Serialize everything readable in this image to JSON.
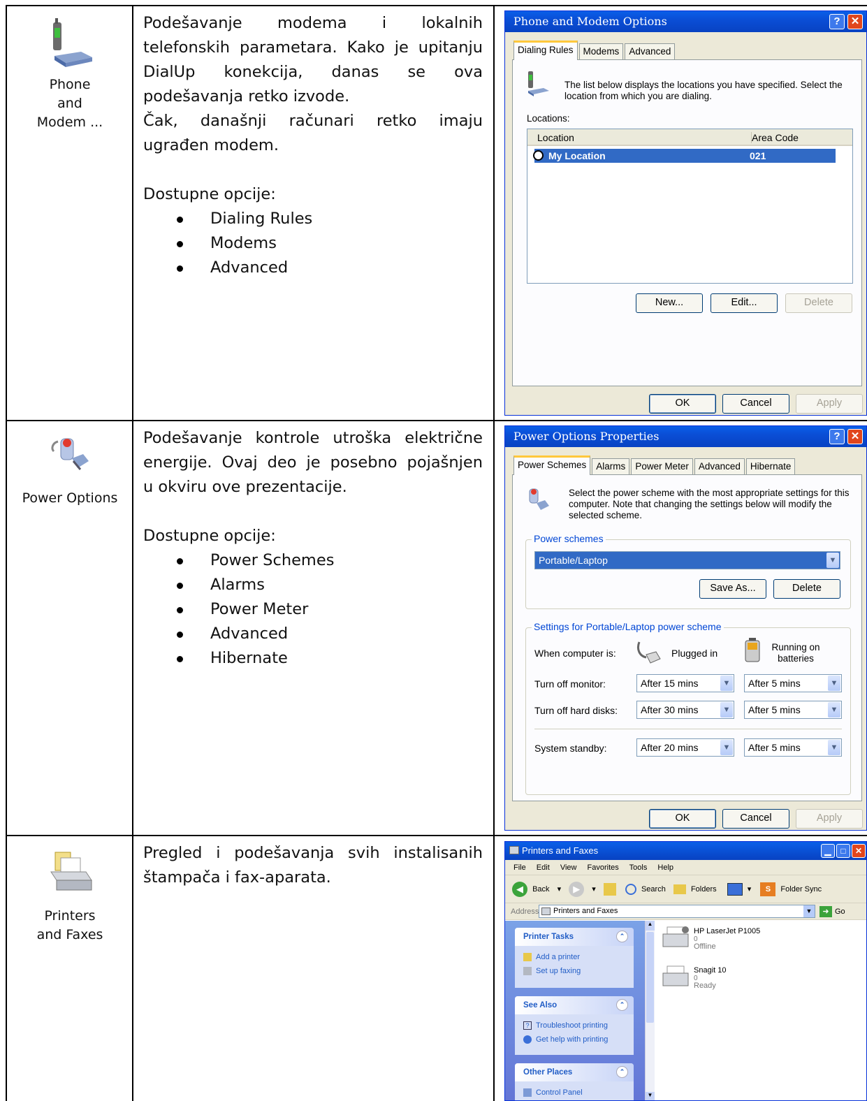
{
  "rows": [
    {
      "icon_label": "Phone and Modem ...",
      "icon": "phone-modem-icon",
      "para1": [
        "Podešavanje modema i lokalnih",
        "telefonskih parametara. Kako je upitanju",
        "DialUp konekcija, danas se ova",
        "podešavanja retko izvode."
      ],
      "para2": [
        "Čak, današnji računari retko imaju",
        "ugrađen modem."
      ],
      "options_title": "Dostupne opcije:",
      "options": [
        "Dialing Rules",
        "Modems",
        "Advanced"
      ]
    },
    {
      "icon_label": "Power Options",
      "icon": "power-options-icon",
      "para1": [
        "Podešavanje kontrole utroška električne",
        "energije. Ovaj deo je posebno pojašnjen",
        "u okviru ove prezentacije."
      ],
      "options_title": "Dostupne opcije:",
      "options": [
        "Power Schemes",
        "Alarms",
        "Power Meter",
        "Advanced",
        "Hibernate"
      ]
    },
    {
      "icon_label": "Printers and Faxes",
      "icon": "printers-faxes-icon",
      "para1": [
        "Pregled i podešavanja svih instalisanih",
        "štampača i fax-aparata."
      ]
    }
  ],
  "phone_dialog": {
    "title": "Phone and Modem Options",
    "tabs": [
      "Dialing Rules",
      "Modems",
      "Advanced"
    ],
    "description": "The list below displays the locations you have specified. Select the location from which you are dialing.",
    "locations_label": "Locations:",
    "columns": [
      "Location",
      "Area Code"
    ],
    "rows": [
      {
        "location": "My Location",
        "area_code": "021"
      }
    ],
    "buttons": [
      "New...",
      "Edit...",
      "Delete"
    ],
    "footer": [
      "OK",
      "Cancel",
      "Apply"
    ]
  },
  "power_dialog": {
    "title": "Power Options Properties",
    "tabs": [
      "Power Schemes",
      "Alarms",
      "Power Meter",
      "Advanced",
      "Hibernate"
    ],
    "description": "Select the power scheme with the most appropriate settings for this computer. Note that changing the settings below will modify the selected scheme.",
    "schemes_group": "Power schemes",
    "scheme_value": "Portable/Laptop",
    "save_as": "Save As...",
    "delete": "Delete",
    "settings_group": "Settings for Portable/Laptop power scheme",
    "when_label": "When computer is:",
    "plugged": "Plugged in",
    "batteries": "Running on batteries",
    "settings": [
      {
        "label": "Turn off monitor:",
        "plugged": "After 15 mins",
        "battery": "After 5 mins"
      },
      {
        "label": "Turn off hard disks:",
        "plugged": "After 30 mins",
        "battery": "After 5 mins"
      },
      {
        "label": "System standby:",
        "plugged": "After 20 mins",
        "battery": "After 5 mins"
      }
    ],
    "footer": [
      "OK",
      "Cancel",
      "Apply"
    ]
  },
  "printers_window": {
    "title": "Printers and Faxes",
    "menu": [
      "File",
      "Edit",
      "View",
      "Favorites",
      "Tools",
      "Help"
    ],
    "toolbar": {
      "back": "Back",
      "search": "Search",
      "folders": "Folders",
      "folder_sync": "Folder Sync"
    },
    "address_label": "Address",
    "address_value": "Printers and Faxes",
    "go": "Go",
    "printer_tasks": {
      "title": "Printer Tasks",
      "items": [
        "Add a printer",
        "Set up faxing"
      ]
    },
    "see_also": {
      "title": "See Also",
      "items": [
        "Troubleshoot printing",
        "Get help with printing"
      ]
    },
    "other_places": {
      "title": "Other Places",
      "items": [
        "Control Panel"
      ]
    },
    "printers": [
      {
        "name": "HP LaserJet P1005",
        "count": "0",
        "status": "Offline"
      },
      {
        "name": "Snagit 10",
        "count": "0",
        "status": "Ready"
      }
    ]
  }
}
